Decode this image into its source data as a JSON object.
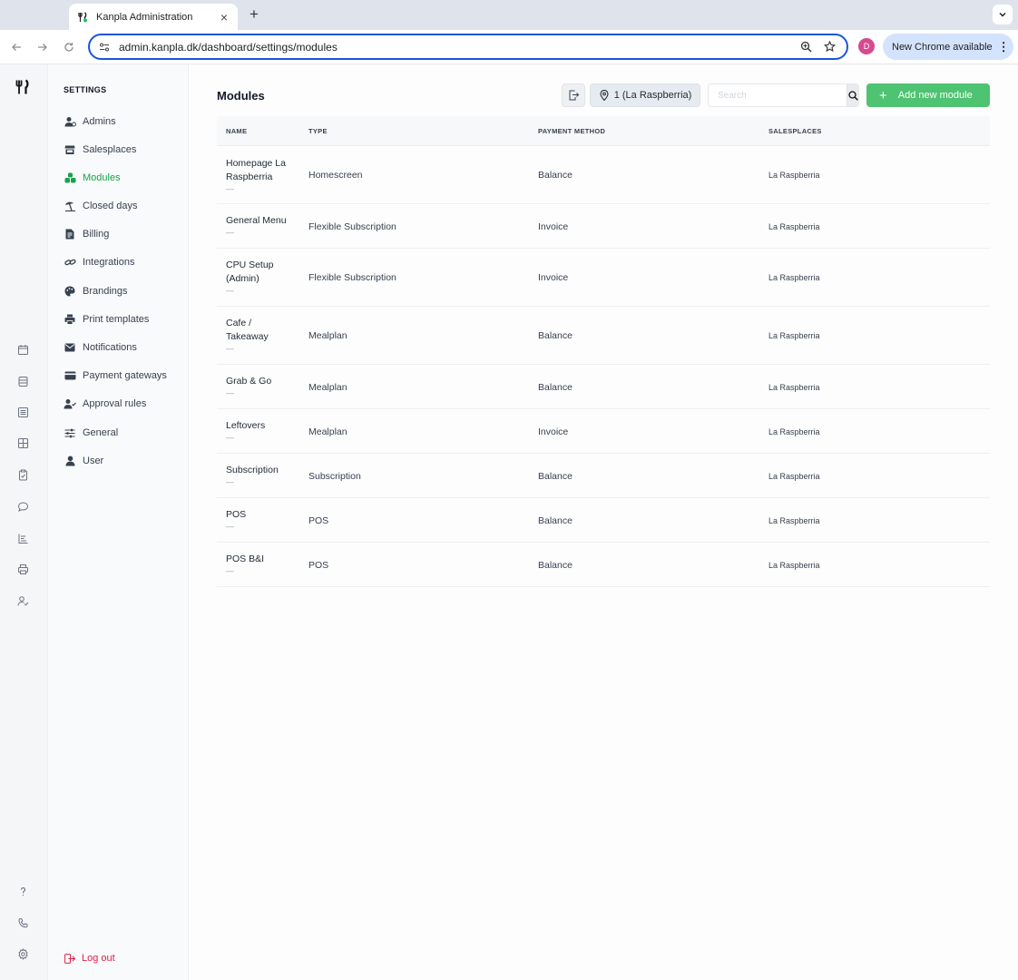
{
  "browser": {
    "tab_title": "Kanpla Administration",
    "url": "admin.kanpla.dk/dashboard/settings/modules",
    "profile_initial": "D",
    "update_label": "New Chrome available"
  },
  "settings": {
    "heading": "SETTINGS",
    "items": [
      {
        "label": "Admins",
        "icon": "admins-icon"
      },
      {
        "label": "Salesplaces",
        "icon": "store-icon"
      },
      {
        "label": "Modules",
        "icon": "modules-icon",
        "active": true
      },
      {
        "label": "Closed days",
        "icon": "beach-umbrella-icon"
      },
      {
        "label": "Billing",
        "icon": "invoice-icon"
      },
      {
        "label": "Integrations",
        "icon": "link-icon"
      },
      {
        "label": "Brandings",
        "icon": "palette-icon"
      },
      {
        "label": "Print templates",
        "icon": "printer-icon"
      },
      {
        "label": "Notifications",
        "icon": "envelope-icon"
      },
      {
        "label": "Payment gateways",
        "icon": "credit-card-icon"
      },
      {
        "label": "Approval rules",
        "icon": "user-check-icon"
      },
      {
        "label": "General",
        "icon": "sliders-icon"
      },
      {
        "label": "User",
        "icon": "user-icon"
      }
    ],
    "logout_label": "Log out"
  },
  "main": {
    "title": "Modules",
    "location_filter": "1 (La Raspberria)",
    "search_placeholder": "Search",
    "add_button": "Add new module",
    "columns": {
      "name": "NAME",
      "type": "TYPE",
      "payment": "PAYMENT METHOD",
      "salesplaces": "SALESPLACES"
    },
    "rows": [
      {
        "name": "Homepage La Raspberria",
        "sub": "—",
        "type": "Homescreen",
        "payment": "Balance",
        "salesplaces": "La Raspberria"
      },
      {
        "name": "General Menu",
        "sub": "—",
        "type": "Flexible Subscription",
        "payment": "Invoice",
        "salesplaces": "La Raspberria"
      },
      {
        "name": "CPU Setup (Admin)",
        "sub": "—",
        "type": "Flexible Subscription",
        "payment": "Invoice",
        "salesplaces": "La Raspberria"
      },
      {
        "name": "Cafe / Takeaway",
        "sub": "—",
        "type": "Mealplan",
        "payment": "Balance",
        "salesplaces": "La Raspberria"
      },
      {
        "name": "Grab & Go",
        "sub": "—",
        "type": "Mealplan",
        "payment": "Balance",
        "salesplaces": "La Raspberria"
      },
      {
        "name": "Leftovers",
        "sub": "—",
        "type": "Mealplan",
        "payment": "Invoice",
        "salesplaces": "La Raspberria"
      },
      {
        "name": "Subscription",
        "sub": "—",
        "type": "Subscription",
        "payment": "Balance",
        "salesplaces": "La Raspberria"
      },
      {
        "name": "POS",
        "sub": "—",
        "type": "POS",
        "payment": "Balance",
        "salesplaces": "La Raspberria"
      },
      {
        "name": "POS B&I",
        "sub": "—",
        "type": "POS",
        "payment": "Balance",
        "salesplaces": "La Raspberria"
      }
    ]
  },
  "colors": {
    "accent": "#4ec372",
    "active_nav": "#16a34a",
    "logout": "#e11d48"
  }
}
